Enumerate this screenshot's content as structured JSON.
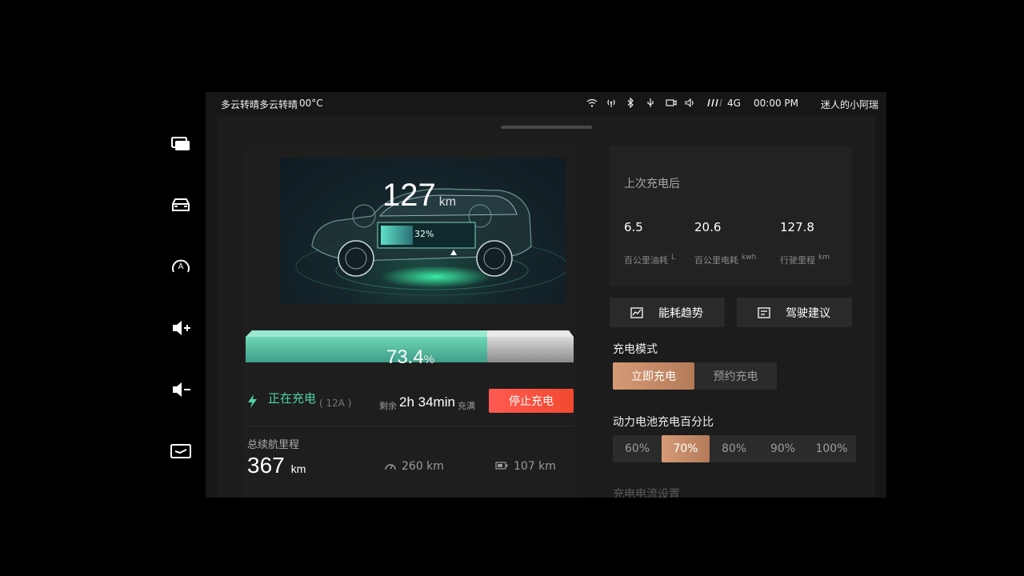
{
  "status": {
    "weather": "多云转晴多云转晴",
    "temperature": "00°C",
    "network": "4G",
    "time": "00:00 PM",
    "user": "迷人的小阿瑞"
  },
  "hero": {
    "range_value": "127",
    "range_unit": "km",
    "battery_inset": "32%"
  },
  "charge": {
    "percent": "73.4",
    "percent_sign": "%",
    "level": 0.734,
    "status": "正在充电",
    "current": "( 12A )",
    "remaining_prefix": "剩余",
    "remaining_time": "2h 34min",
    "remaining_suffix": "充满",
    "stop_label": "停止充电"
  },
  "mileage": {
    "title": "总续航里程",
    "total": "367",
    "total_unit": "km",
    "fuel_range": "260 km",
    "battery_range": "107 km"
  },
  "last_charge": {
    "title": "上次充电后",
    "stats": [
      {
        "value": "6.5",
        "label": "百公里油耗",
        "unit": "L"
      },
      {
        "value": "20.6",
        "label": "百公里电耗",
        "unit": "kwh"
      },
      {
        "value": "127.8",
        "label": "行驶里程",
        "unit": "km"
      }
    ]
  },
  "buttons": {
    "energy_trend": "能耗趋势",
    "driving_advice": "驾驶建议"
  },
  "charge_mode": {
    "title": "充电模式",
    "options": [
      "立即充电",
      "预约充电"
    ],
    "selected": "立即充电"
  },
  "charge_limit": {
    "title": "动力电池充电百分比",
    "options": [
      "60%",
      "70%",
      "80%",
      "90%",
      "100%"
    ],
    "selected": "70%"
  },
  "current_setting": {
    "title": "充电电流设置"
  },
  "colors": {
    "accent_green": "#4fd1a8",
    "accent_copper": "#c98e6a",
    "stop_red": "#f24f40"
  }
}
